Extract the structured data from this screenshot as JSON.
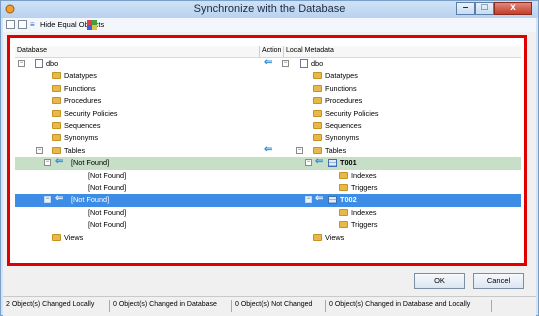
{
  "window": {
    "title": "Synchronize with the Database",
    "minimize_glyph": "–",
    "maximize_glyph": "□",
    "close_glyph": "x"
  },
  "toolbar": {
    "hide_equal_label": "Hide Equal Objects",
    "collapse_icon": "collapse-all-icon",
    "expand_icon": "expand-all-icon",
    "palette_icon": "color-palette-icon"
  },
  "grid": {
    "col_database": "Database",
    "col_action": "Action",
    "col_local": "Local Metadata"
  },
  "tree": {
    "dbo_left": "dbo",
    "dbo_right": "dbo",
    "datatypes": "Datatypes",
    "functions": "Functions",
    "procedures": "Procedures",
    "security": "Security Policies",
    "sequences": "Sequences",
    "synonyms": "Synonyms",
    "tables": "Tables",
    "not_found": "[Not Found]",
    "t001": "T001",
    "t002": "T002",
    "indexes": "Indexes",
    "triggers": "Triggers",
    "views": "Views"
  },
  "buttons": {
    "ok": "OK",
    "cancel": "Cancel"
  },
  "status": {
    "s1": "2 Object(s) Changed Locally",
    "s2": "0 Object(s) Changed in Database",
    "s3": "0 Object(s) Not Changed",
    "s4": "0 Object(s) Changed in Database and Locally"
  },
  "colors": {
    "frame_highlight": "#e00000",
    "row_green": "#c8dfc7",
    "row_blue": "#3d8ce6",
    "arrow": "#2f8fd8"
  }
}
